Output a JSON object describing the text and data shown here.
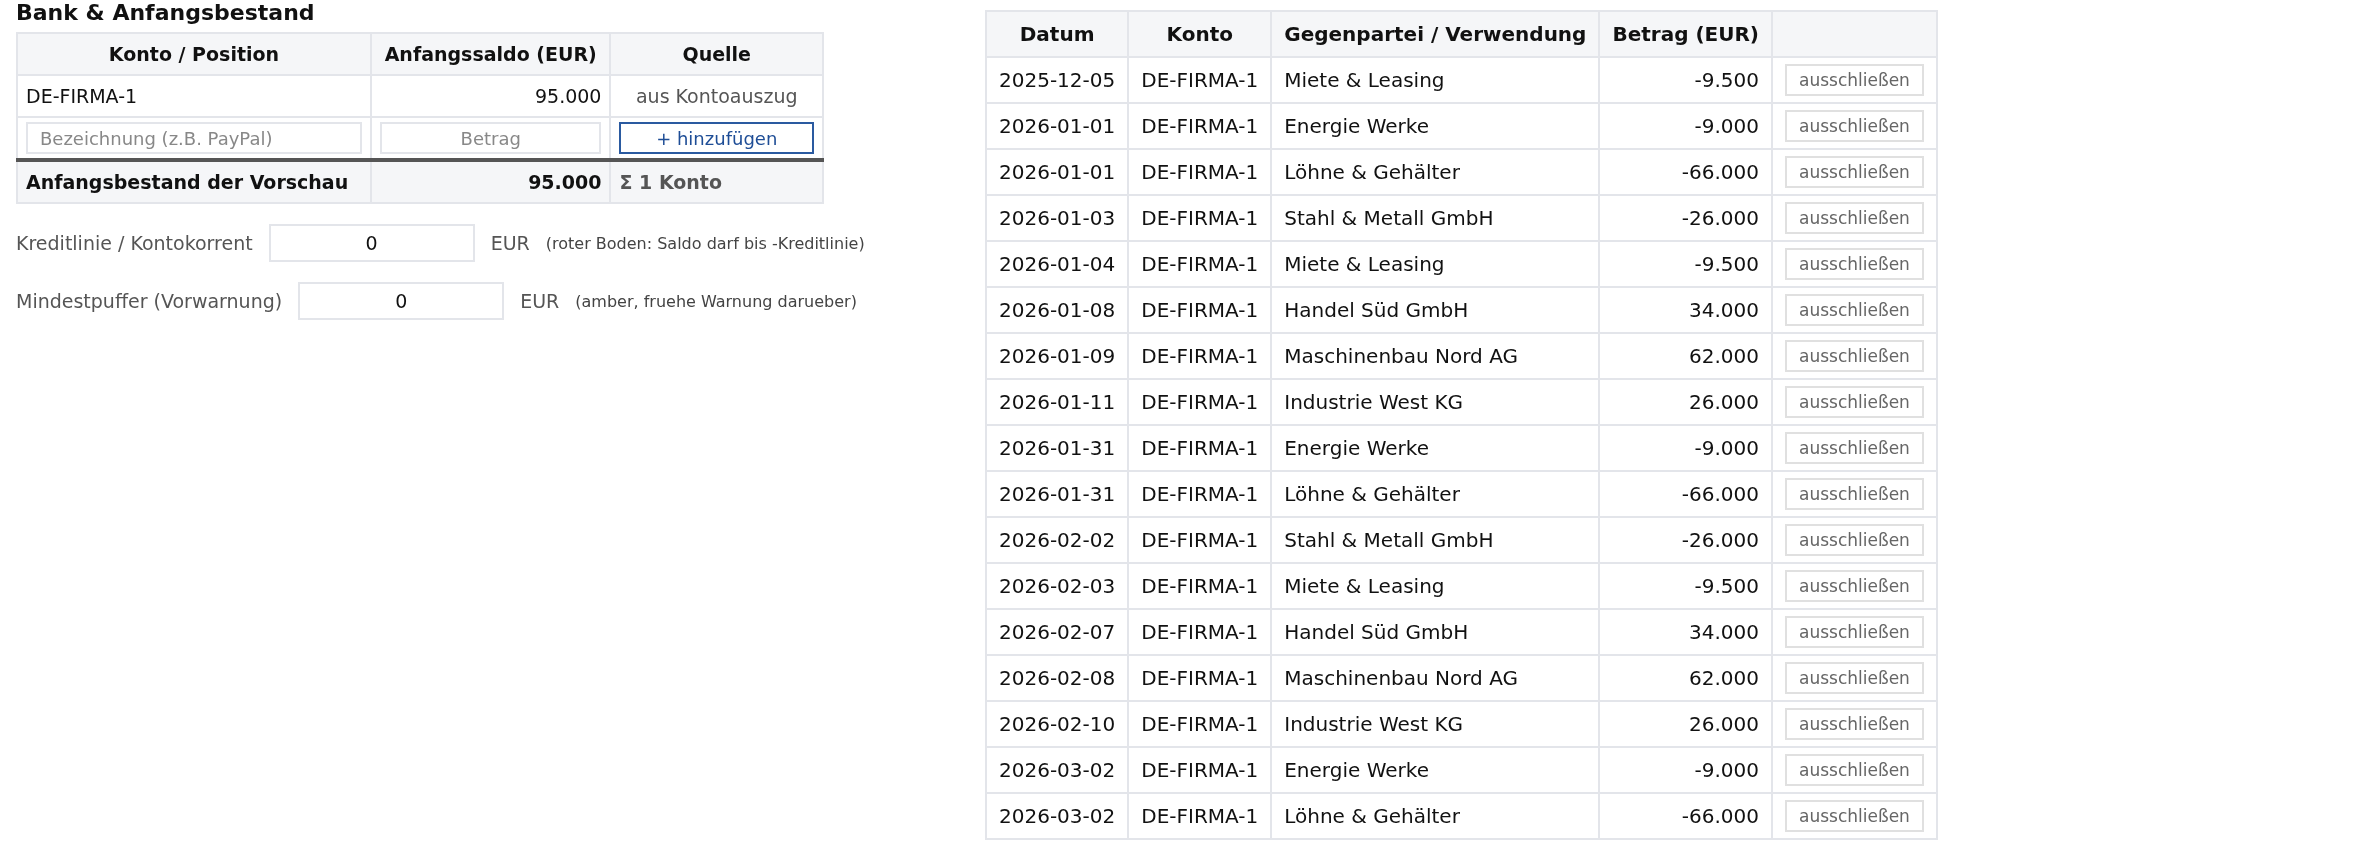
{
  "bank": {
    "title": "Bank & Anfangsbestand",
    "columns": [
      "Konto / Position",
      "Anfangssaldo (EUR)",
      "Quelle"
    ],
    "rows": [
      {
        "konto": "DE-FIRMA-1",
        "saldo": "95.000",
        "quelle": "aus Kontoauszug"
      }
    ],
    "new_row": {
      "name_placeholder": "Bezeichnung (z.B. PayPal)",
      "amount_placeholder": "Betrag",
      "add_button": "+ hinzufügen"
    },
    "total": {
      "label": "Anfangsbestand der Vorschau",
      "value": "95.000",
      "count": "Σ 1 Konto"
    },
    "settings": [
      {
        "label": "Kreditlinie / Kontokorrent",
        "value": "0",
        "unit": "EUR",
        "note": "(roter Boden: Saldo darf bis -Kreditlinie)"
      },
      {
        "label": "Mindestpuffer (Vorwarnung)",
        "value": "0",
        "unit": "EUR",
        "note": "(amber, fruehe Warnung darueber)"
      }
    ]
  },
  "transactions": {
    "columns": [
      "Datum",
      "Konto",
      "Gegenpartei / Verwendung",
      "Betrag (EUR)"
    ],
    "rows": [
      {
        "date": "2025-12-05",
        "konto": "DE-FIRMA-1",
        "party": "Miete & Leasing",
        "amount": "-9.500",
        "action": "ausschließen"
      },
      {
        "date": "2026-01-01",
        "konto": "DE-FIRMA-1",
        "party": "Energie Werke",
        "amount": "-9.000",
        "action": "ausschließen"
      },
      {
        "date": "2026-01-01",
        "konto": "DE-FIRMA-1",
        "party": "Löhne & Gehälter",
        "amount": "-66.000",
        "action": "ausschließen"
      },
      {
        "date": "2026-01-03",
        "konto": "DE-FIRMA-1",
        "party": "Stahl & Metall GmbH",
        "amount": "-26.000",
        "action": "ausschließen"
      },
      {
        "date": "2026-01-04",
        "konto": "DE-FIRMA-1",
        "party": "Miete & Leasing",
        "amount": "-9.500",
        "action": "ausschließen"
      },
      {
        "date": "2026-01-08",
        "konto": "DE-FIRMA-1",
        "party": "Handel Süd GmbH",
        "amount": "34.000",
        "action": "ausschließen"
      },
      {
        "date": "2026-01-09",
        "konto": "DE-FIRMA-1",
        "party": "Maschinenbau Nord AG",
        "amount": "62.000",
        "action": "ausschließen"
      },
      {
        "date": "2026-01-11",
        "konto": "DE-FIRMA-1",
        "party": "Industrie West KG",
        "amount": "26.000",
        "action": "ausschließen"
      },
      {
        "date": "2026-01-31",
        "konto": "DE-FIRMA-1",
        "party": "Energie Werke",
        "amount": "-9.000",
        "action": "ausschließen"
      },
      {
        "date": "2026-01-31",
        "konto": "DE-FIRMA-1",
        "party": "Löhne & Gehälter",
        "amount": "-66.000",
        "action": "ausschließen"
      },
      {
        "date": "2026-02-02",
        "konto": "DE-FIRMA-1",
        "party": "Stahl & Metall GmbH",
        "amount": "-26.000",
        "action": "ausschließen"
      },
      {
        "date": "2026-02-03",
        "konto": "DE-FIRMA-1",
        "party": "Miete & Leasing",
        "amount": "-9.500",
        "action": "ausschließen"
      },
      {
        "date": "2026-02-07",
        "konto": "DE-FIRMA-1",
        "party": "Handel Süd GmbH",
        "amount": "34.000",
        "action": "ausschließen"
      },
      {
        "date": "2026-02-08",
        "konto": "DE-FIRMA-1",
        "party": "Maschinenbau Nord AG",
        "amount": "62.000",
        "action": "ausschließen"
      },
      {
        "date": "2026-02-10",
        "konto": "DE-FIRMA-1",
        "party": "Industrie West KG",
        "amount": "26.000",
        "action": "ausschließen"
      },
      {
        "date": "2026-03-02",
        "konto": "DE-FIRMA-1",
        "party": "Energie Werke",
        "amount": "-9.000",
        "action": "ausschließen"
      },
      {
        "date": "2026-03-02",
        "konto": "DE-FIRMA-1",
        "party": "Löhne & Gehälter",
        "amount": "-66.000",
        "action": "ausschließen"
      }
    ]
  }
}
